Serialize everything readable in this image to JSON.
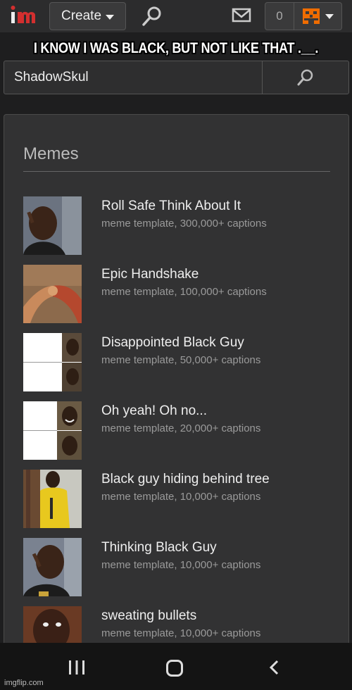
{
  "nav": {
    "logo_text": "im",
    "create_label": "Create",
    "notification_count": "0"
  },
  "caption": "I KNOW I WAS BLACK, BUT NOT LIKE THAT .__.",
  "search": {
    "value": "ShadowSkul"
  },
  "results": {
    "title": "Memes",
    "items": [
      {
        "name": "Roll Safe Think About It",
        "sub": "meme template, 300,000+ captions",
        "thumb": "man-pointing-head"
      },
      {
        "name": "Epic Handshake",
        "sub": "meme template, 100,000+ captions",
        "thumb": "arm-wrestle-handshake"
      },
      {
        "name": "Disappointed Black Guy",
        "sub": "meme template, 50,000+ captions",
        "thumb": "two-panel-disappointed"
      },
      {
        "name": "Oh yeah! Oh no...",
        "sub": "meme template, 20,000+ captions",
        "thumb": "two-panel-oh-yeah"
      },
      {
        "name": "Black guy hiding behind tree",
        "sub": "meme template, 10,000+ captions",
        "thumb": "man-behind-tree"
      },
      {
        "name": "Thinking Black Guy",
        "sub": "meme template, 10,000+ captions",
        "thumb": "man-thinking"
      },
      {
        "name": "sweating bullets",
        "sub": "meme template, 10,000+ captions",
        "thumb": "man-sweating"
      }
    ]
  },
  "watermark": "imgflip.com",
  "colors": {
    "brand_red": "#d32f2f",
    "avatar_orange": "#ef6c00"
  }
}
